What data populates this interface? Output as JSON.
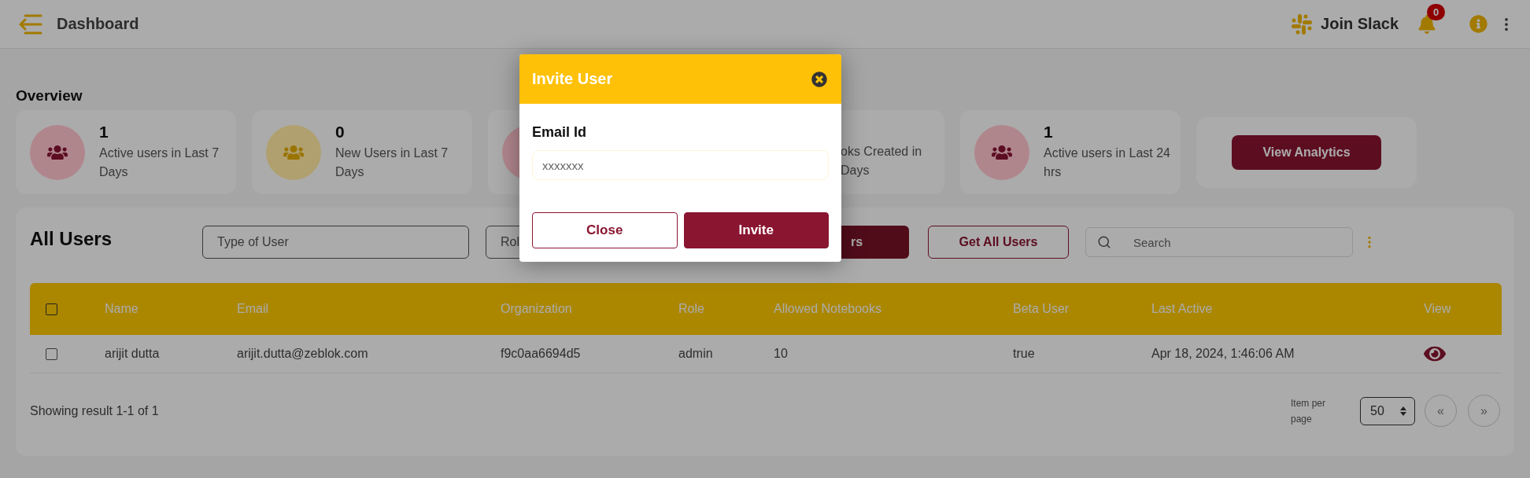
{
  "topbar": {
    "title": "Dashboard",
    "slack_label": "Join Slack",
    "notification_count": "0"
  },
  "overview": {
    "title": "Overview",
    "cards": [
      {
        "kind": "stat",
        "color": "#b0868d",
        "value": "1",
        "label_lines": [
          "Active users in Last 7",
          "Days"
        ]
      },
      {
        "kind": "stat",
        "color": "#b0a070",
        "value": "0",
        "label_lines": [
          "New Users in Last 7",
          "Days"
        ]
      },
      {
        "kind": "covered",
        "color": "#b0868d"
      },
      {
        "kind": "clipped",
        "label_lines": [
          "oks Created in",
          "Days"
        ]
      },
      {
        "kind": "stat",
        "color": "#b0868d",
        "value": "1",
        "label_lines": [
          "Active users in Last 24",
          "hrs"
        ]
      }
    ],
    "analytics_button": "View Analytics"
  },
  "users": {
    "title": "All Users",
    "filters": [
      {
        "placeholder": "Type of User"
      },
      {
        "placeholder": "Rol"
      }
    ],
    "covered_button": "rs",
    "get_all_button": "Get All Users",
    "search": {
      "placeholder": "Search"
    },
    "table": {
      "header_checked": false,
      "columns": [
        "Name",
        "Email",
        "Organization",
        "Role",
        "Allowed Notebooks",
        "Beta User",
        "Last Active",
        "View"
      ],
      "rows": [
        {
          "checked": false,
          "cells": [
            "arijit dutta",
            "arijit.dutta@zeblok.com",
            "f9c0aa6694d5",
            "admin",
            "10",
            "true",
            "Apr 18, 2024, 1:46:06 AM"
          ]
        }
      ]
    },
    "footer": {
      "summary": "Showing result 1-1 of 1",
      "per_page_label": "Item per page",
      "page_size": "50",
      "prev": "«",
      "next": "»"
    }
  },
  "modal": {
    "title": "Invite User",
    "field_label": "Email Id",
    "placeholder": "xxxxxxx",
    "buttons": [
      {
        "kind": "outline",
        "label": "Close"
      },
      {
        "kind": "primary",
        "label": "Invite"
      }
    ]
  }
}
